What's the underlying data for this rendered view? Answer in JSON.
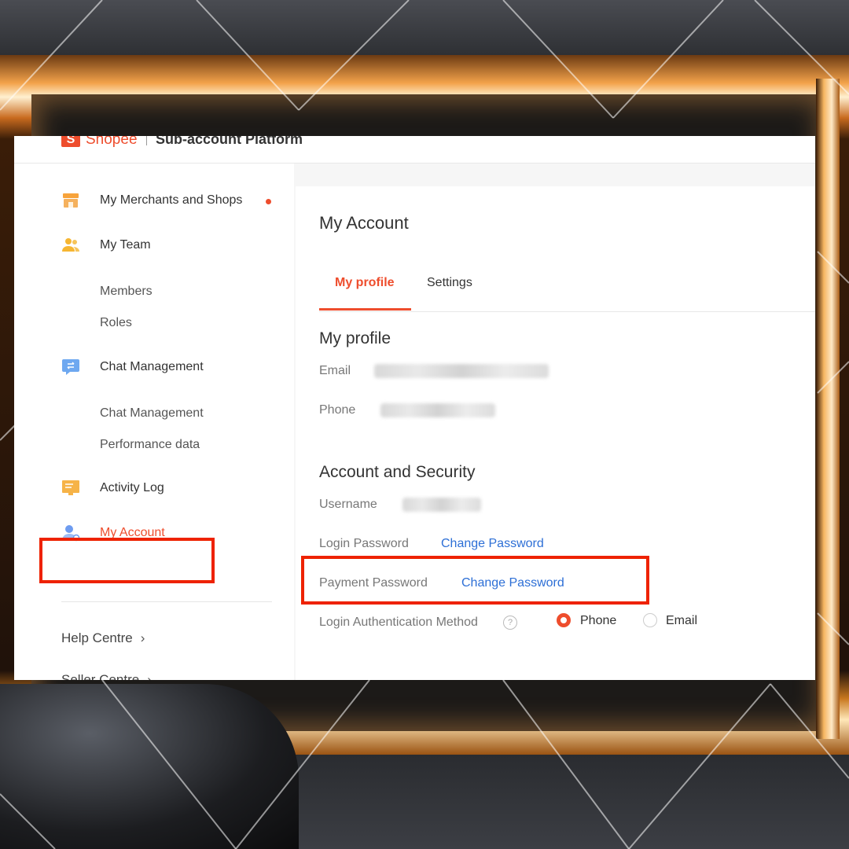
{
  "header": {
    "logo_letter": "S",
    "brand": "Shopee",
    "platform_title": "Sub-account Platform"
  },
  "sidebar": {
    "items": [
      {
        "label": "My Merchants and Shops",
        "icon": "shop-icon",
        "has_dot": true
      },
      {
        "label": "My Team",
        "icon": "team-icon"
      },
      {
        "label": "Members"
      },
      {
        "label": "Roles"
      },
      {
        "label": "Chat Management",
        "icon": "chat-icon"
      },
      {
        "label": "Chat Management"
      },
      {
        "label": "Performance data"
      },
      {
        "label": "Activity Log",
        "icon": "activity-log-icon"
      },
      {
        "label": "My Account",
        "icon": "account-icon",
        "active": true
      }
    ],
    "footer": [
      {
        "label": "Help Centre"
      },
      {
        "label": "Seller Centre"
      }
    ]
  },
  "main": {
    "title": "My Account",
    "tabs": [
      {
        "label": "My profile",
        "active": true
      },
      {
        "label": "Settings"
      }
    ],
    "profile": {
      "title": "My profile",
      "email_label": "Email",
      "phone_label": "Phone"
    },
    "security": {
      "title": "Account and Security",
      "username_label": "Username",
      "login_password_label": "Login Password",
      "login_password_link": "Change Password",
      "payment_password_label": "Payment Password",
      "payment_password_link": "Change Password",
      "auth_method_label": "Login Authentication Method",
      "auth_options": [
        {
          "label": "Phone",
          "selected": true
        },
        {
          "label": "Email",
          "selected": false
        }
      ]
    }
  },
  "colors": {
    "brand": "#ee4d2d",
    "link": "#2d6fd6",
    "highlight": "#ee2200"
  }
}
